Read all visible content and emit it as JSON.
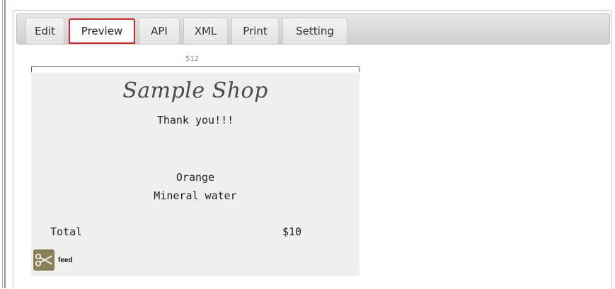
{
  "tabs": [
    {
      "label": "Edit"
    },
    {
      "label": "Preview"
    },
    {
      "label": "API"
    },
    {
      "label": "XML"
    },
    {
      "label": "Print"
    },
    {
      "label": "Setting"
    }
  ],
  "active_tab": "Preview",
  "preview": {
    "paper_width": "512",
    "shop_name": "Sample Shop",
    "thanks": "Thank you!!!",
    "items": [
      "Orange",
      "Mineral water"
    ],
    "total_label": "Total",
    "total_value": "$10",
    "feed_label": "feed",
    "feed_icon": "scissors-icon"
  },
  "colors": {
    "active_tab_border": "#d9232d",
    "receipt_bg": "#efefef",
    "feed_icon_bg": "#8a7f57"
  }
}
